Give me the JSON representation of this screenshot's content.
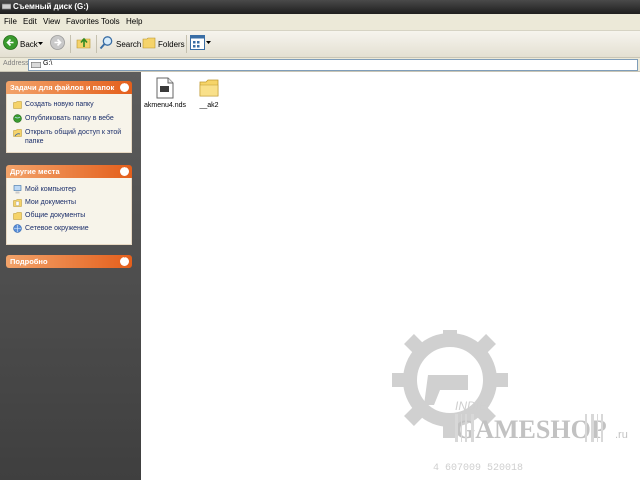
{
  "window": {
    "title": "Съемный диск (G:)"
  },
  "menu": [
    "File",
    "Edit",
    "View",
    "Favorites",
    "Tools",
    "Help"
  ],
  "toolbar": {
    "back_label": "Back",
    "search_label": "Search",
    "folders_label": "Folders"
  },
  "address": {
    "label": "Address",
    "value": "G:\\"
  },
  "panels": {
    "tasks": {
      "title": "Задачи для файлов и папок",
      "items": [
        {
          "label": "Создать новую папку",
          "icon": "new-folder-icon"
        },
        {
          "label": "Опубликовать папку в вебе",
          "icon": "web-publish-icon"
        },
        {
          "label": "Открыть общий доступ к этой папке",
          "icon": "share-folder-icon"
        }
      ]
    },
    "places": {
      "title": "Другие места",
      "items": [
        {
          "label": "Мой компьютер",
          "icon": "computer-icon"
        },
        {
          "label": "Мои документы",
          "icon": "my-documents-icon"
        },
        {
          "label": "Общие документы",
          "icon": "shared-documents-icon"
        },
        {
          "label": "Сетевое окружение",
          "icon": "network-icon"
        }
      ]
    },
    "details": {
      "title": "Подробно"
    }
  },
  "files": [
    {
      "name": "akmenu4.nds",
      "icon": "document-file-icon"
    },
    {
      "name": "__ak2",
      "icon": "folder-icon"
    }
  ],
  "watermark": {
    "top": "INDIE",
    "brand": "GAMESHOP",
    "suffix": ".ru",
    "barcode": "4 607009 520018"
  },
  "colors": {
    "panel_header": "#e45f1c",
    "sidebar_bg": "#4f4f4f",
    "link_text": "#1c2f6b"
  }
}
